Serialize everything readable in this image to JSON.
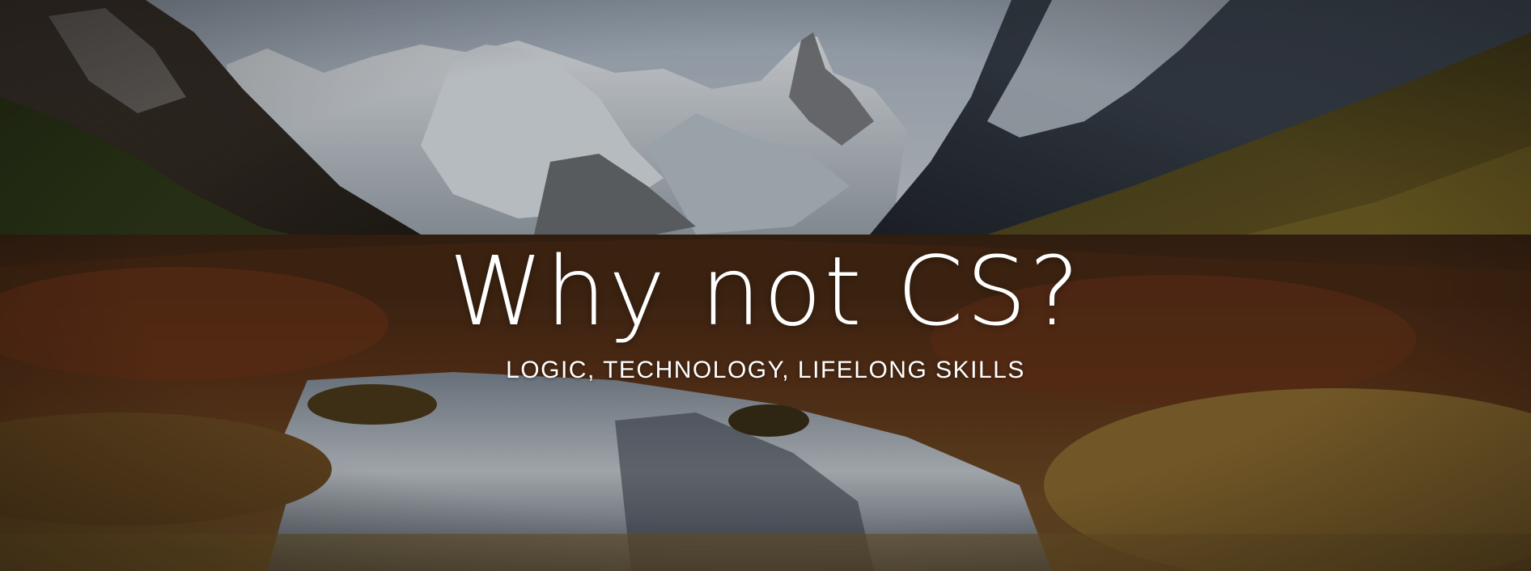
{
  "hero": {
    "title": "Why not CS?",
    "subtitle": "LOGIC, TECHNOLOGY, LIFELONG SKILLS",
    "background_image": "mountain-valley-lake-photo",
    "text_color": "#ffffff"
  }
}
